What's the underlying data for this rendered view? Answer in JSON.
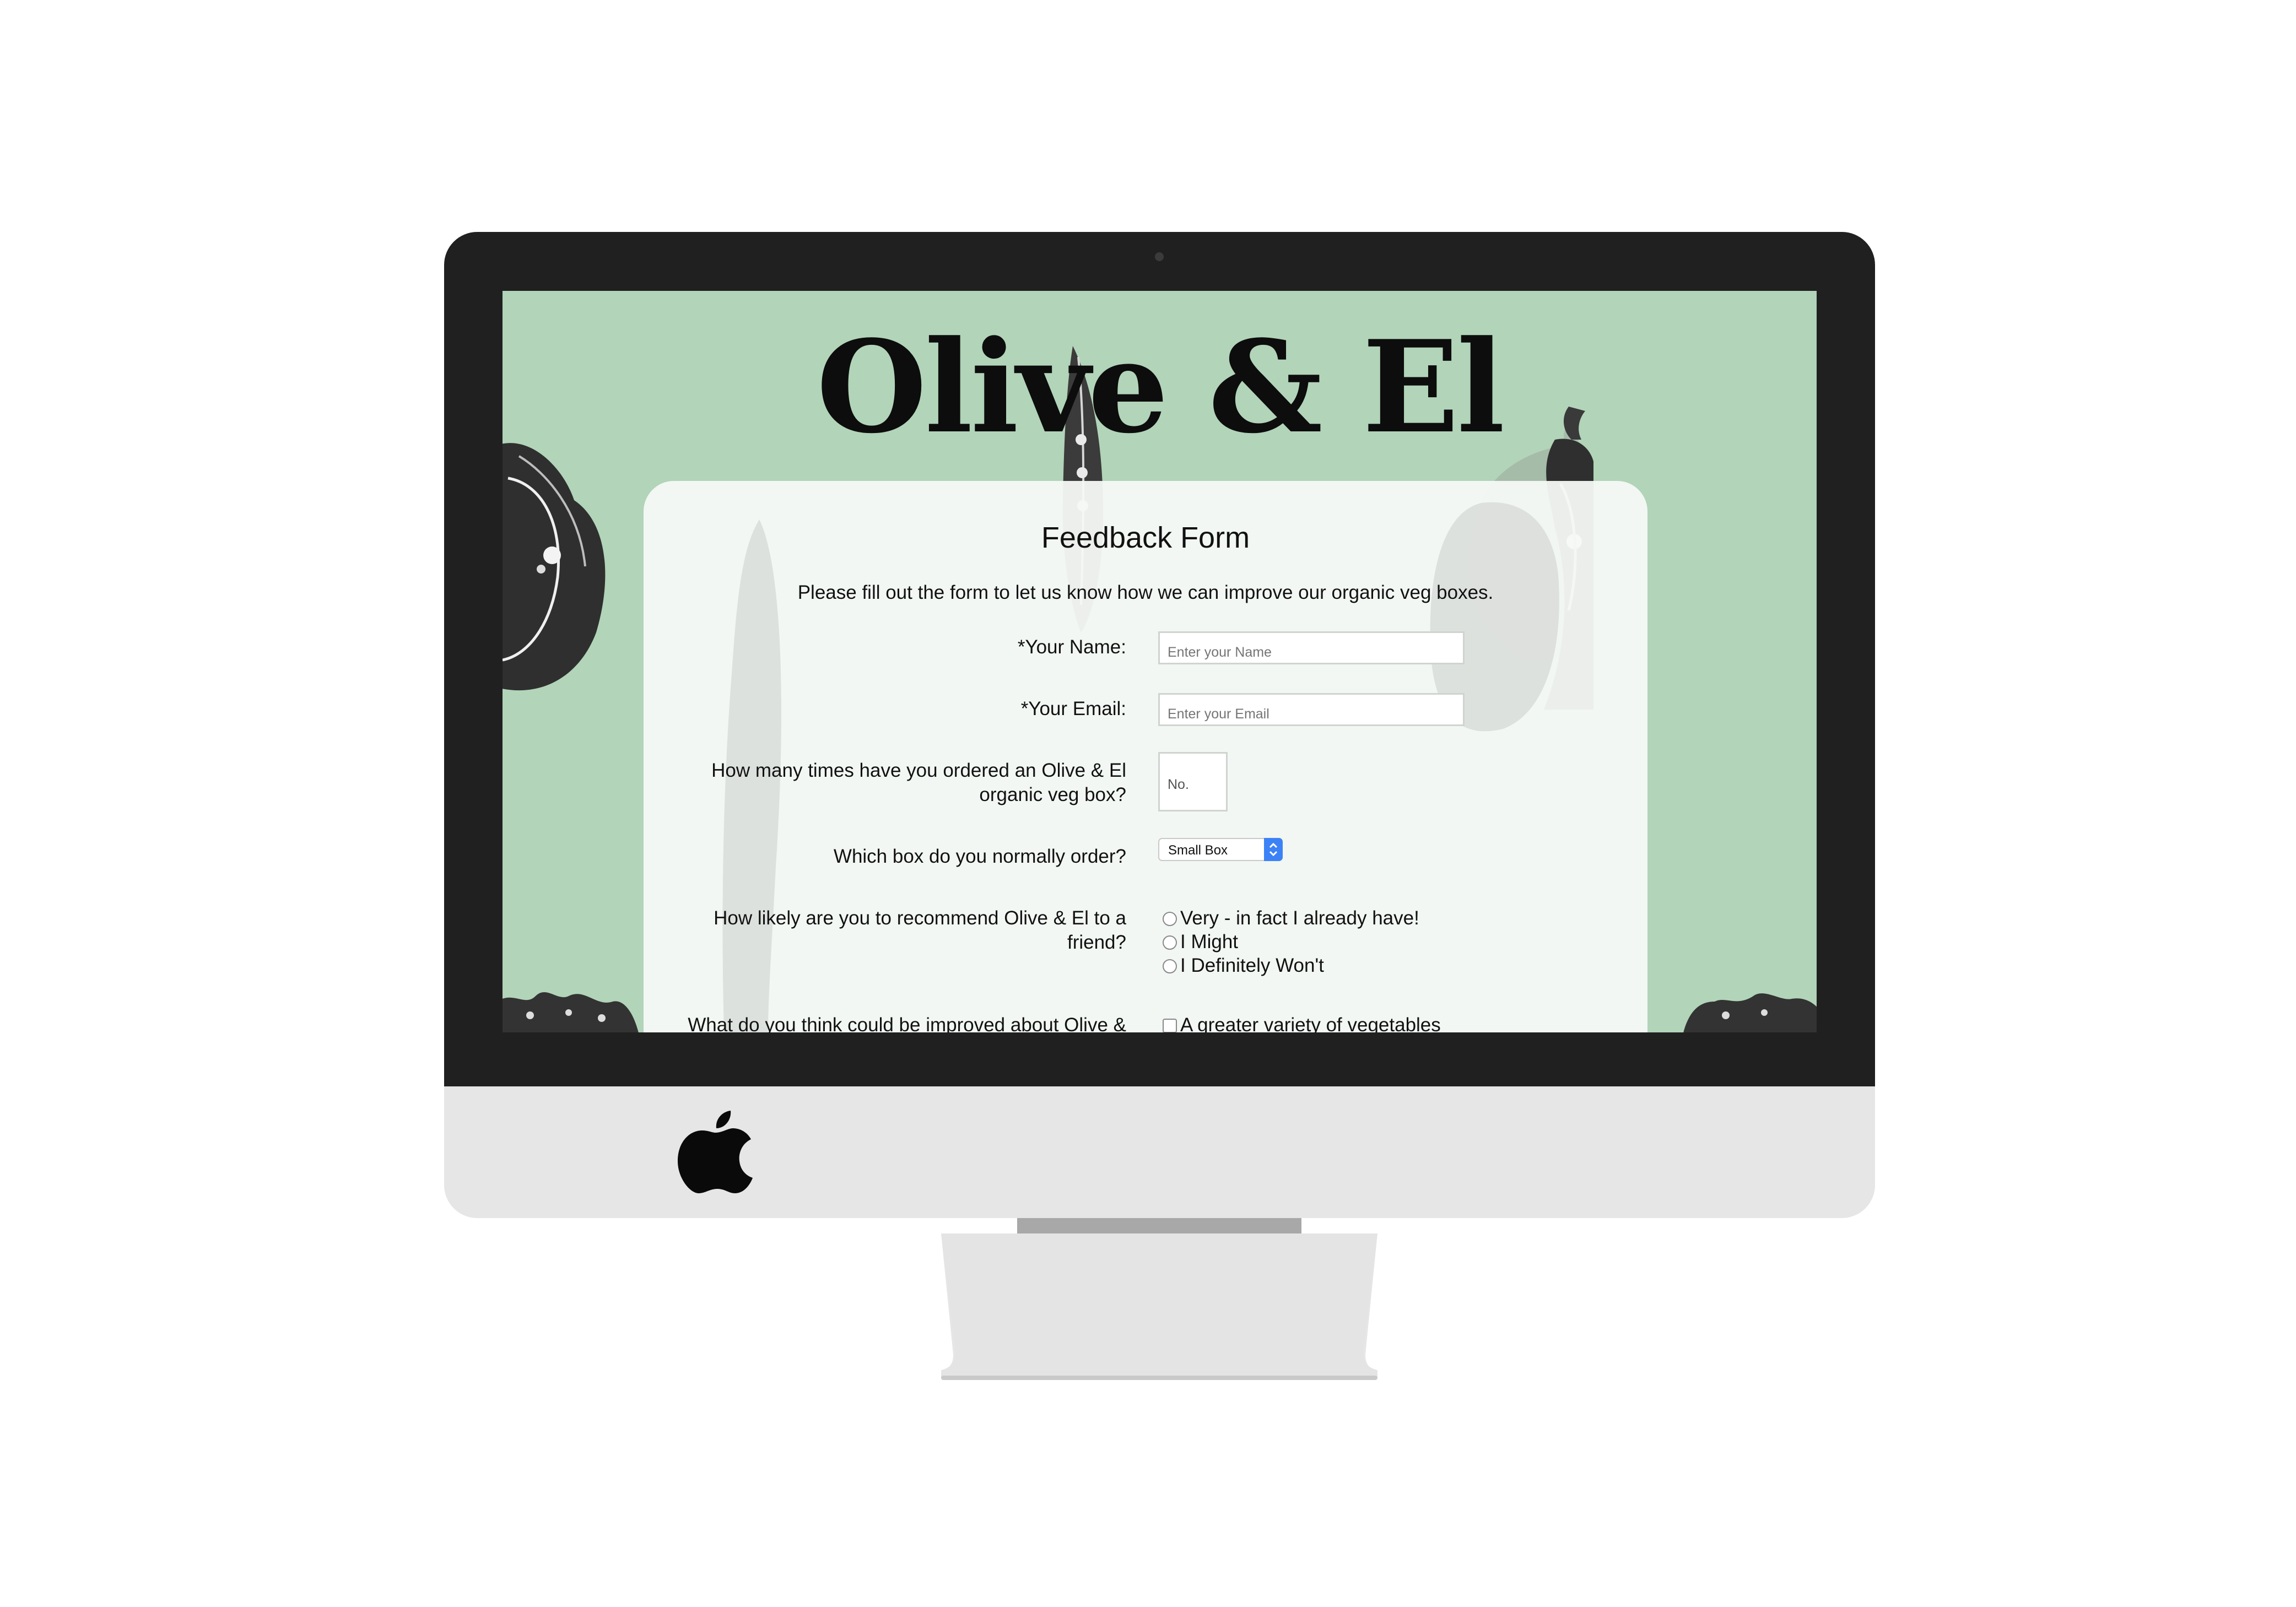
{
  "site": {
    "title": "Olive & El"
  },
  "form": {
    "heading": "Feedback Form",
    "intro": "Please fill out the form to let us know how we can improve our organic veg boxes.",
    "name": {
      "label": "*Your Name:",
      "placeholder": "Enter your Name"
    },
    "email": {
      "label": "*Your Email:",
      "placeholder": "Enter your Email"
    },
    "orders": {
      "label_line1": "How many times have you ordered an Olive & El",
      "label_line2": "organic veg box?",
      "placeholder": "No."
    },
    "box": {
      "label": "Which box do you normally order?",
      "selected": "Small Box"
    },
    "recommend": {
      "label_line1": "How likely are you to recommend Olive & El to a",
      "label_line2": "friend?",
      "options": [
        "Very - in fact I already have!",
        "I Might",
        "I Definitely Won't"
      ]
    },
    "improve": {
      "label": "What do you think could be improved about Olive &",
      "first_option": "A greater variety of vegetables"
    }
  },
  "colors": {
    "screen_background": "#b2d4b9",
    "bezel": "#202020",
    "chin": "#e6e6e6",
    "select_arrow": "#3c82f6"
  },
  "icons": [
    "apple-logo-icon",
    "bell-pepper-illustration",
    "peapod-illustration",
    "corn-illustration",
    "select-arrows-icon"
  ]
}
